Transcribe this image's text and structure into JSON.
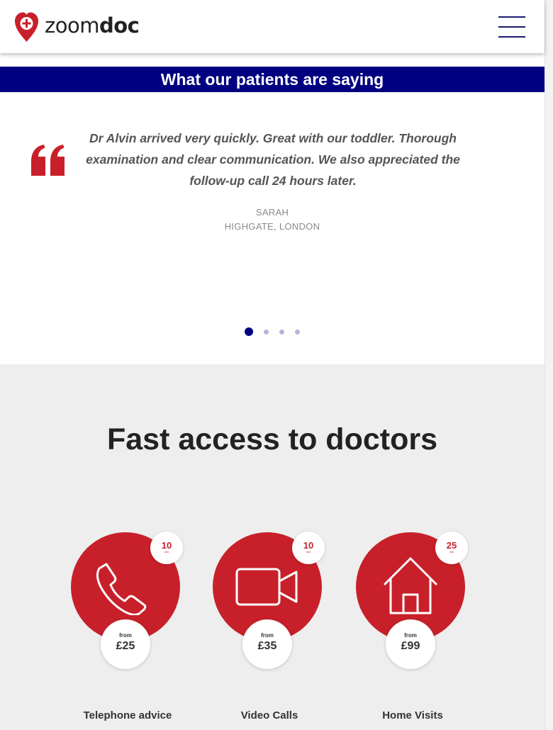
{
  "header": {
    "logo_text_light": "zoom",
    "logo_text_bold": "doc",
    "menu_icon": "hamburger-menu-icon"
  },
  "testimonials": {
    "heading": "What our patients are saying",
    "quote": "Dr Alvin arrived very quickly. Great with our toddler. Thorough examination and clear communication. We also appreciated the follow-up call 24 hours later.",
    "author_name": "SARAH",
    "author_location": "HIGHGATE, LONDON",
    "slide_count": 4,
    "active_slide": 1
  },
  "services": {
    "title": "Fast access to doctors",
    "items": [
      {
        "label": "Telephone advice",
        "time_value": "10",
        "time_unit": "min",
        "price_prefix": "from",
        "price": "£25",
        "icon": "phone-icon"
      },
      {
        "label": "Video Calls",
        "time_value": "10",
        "time_unit": "min",
        "price_prefix": "from",
        "price": "£35",
        "icon": "video-camera-icon"
      },
      {
        "label": "Home Visits",
        "time_value": "25",
        "time_unit": "min",
        "price_prefix": "from",
        "price": "£99",
        "icon": "house-icon"
      }
    ]
  },
  "colors": {
    "brand_red": "#c8202a",
    "navy": "#000080",
    "section_grey": "#eeeeee"
  }
}
